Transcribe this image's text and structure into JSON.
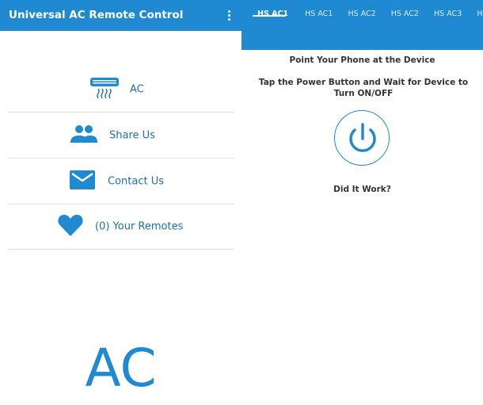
{
  "app": {
    "title": "Universal AC Remote Control"
  },
  "menu": {
    "items": [
      {
        "label": "AC",
        "icon": "air-conditioner-icon"
      },
      {
        "label": "Share Us",
        "icon": "people-icon"
      },
      {
        "label": "Contact Us",
        "icon": "mail-icon"
      },
      {
        "label": "(0) Your Remotes",
        "icon": "heart-icon"
      }
    ]
  },
  "brand_text": "AC",
  "remote": {
    "tabs": [
      "HS AC1",
      "HS AC1",
      "HS AC2",
      "HS AC2",
      "HS AC3",
      "HS AC"
    ],
    "active_tab": 0,
    "instruction_1": "Point Your Phone at the Device",
    "instruction_2": "Tap the Power Button and Wait for Device to Turn ON/OFF",
    "feedback": "Did It Work?"
  },
  "colors": {
    "primary": "#1f8ad2",
    "label_blue": "#1f6fb0",
    "text_dark": "#333333"
  }
}
